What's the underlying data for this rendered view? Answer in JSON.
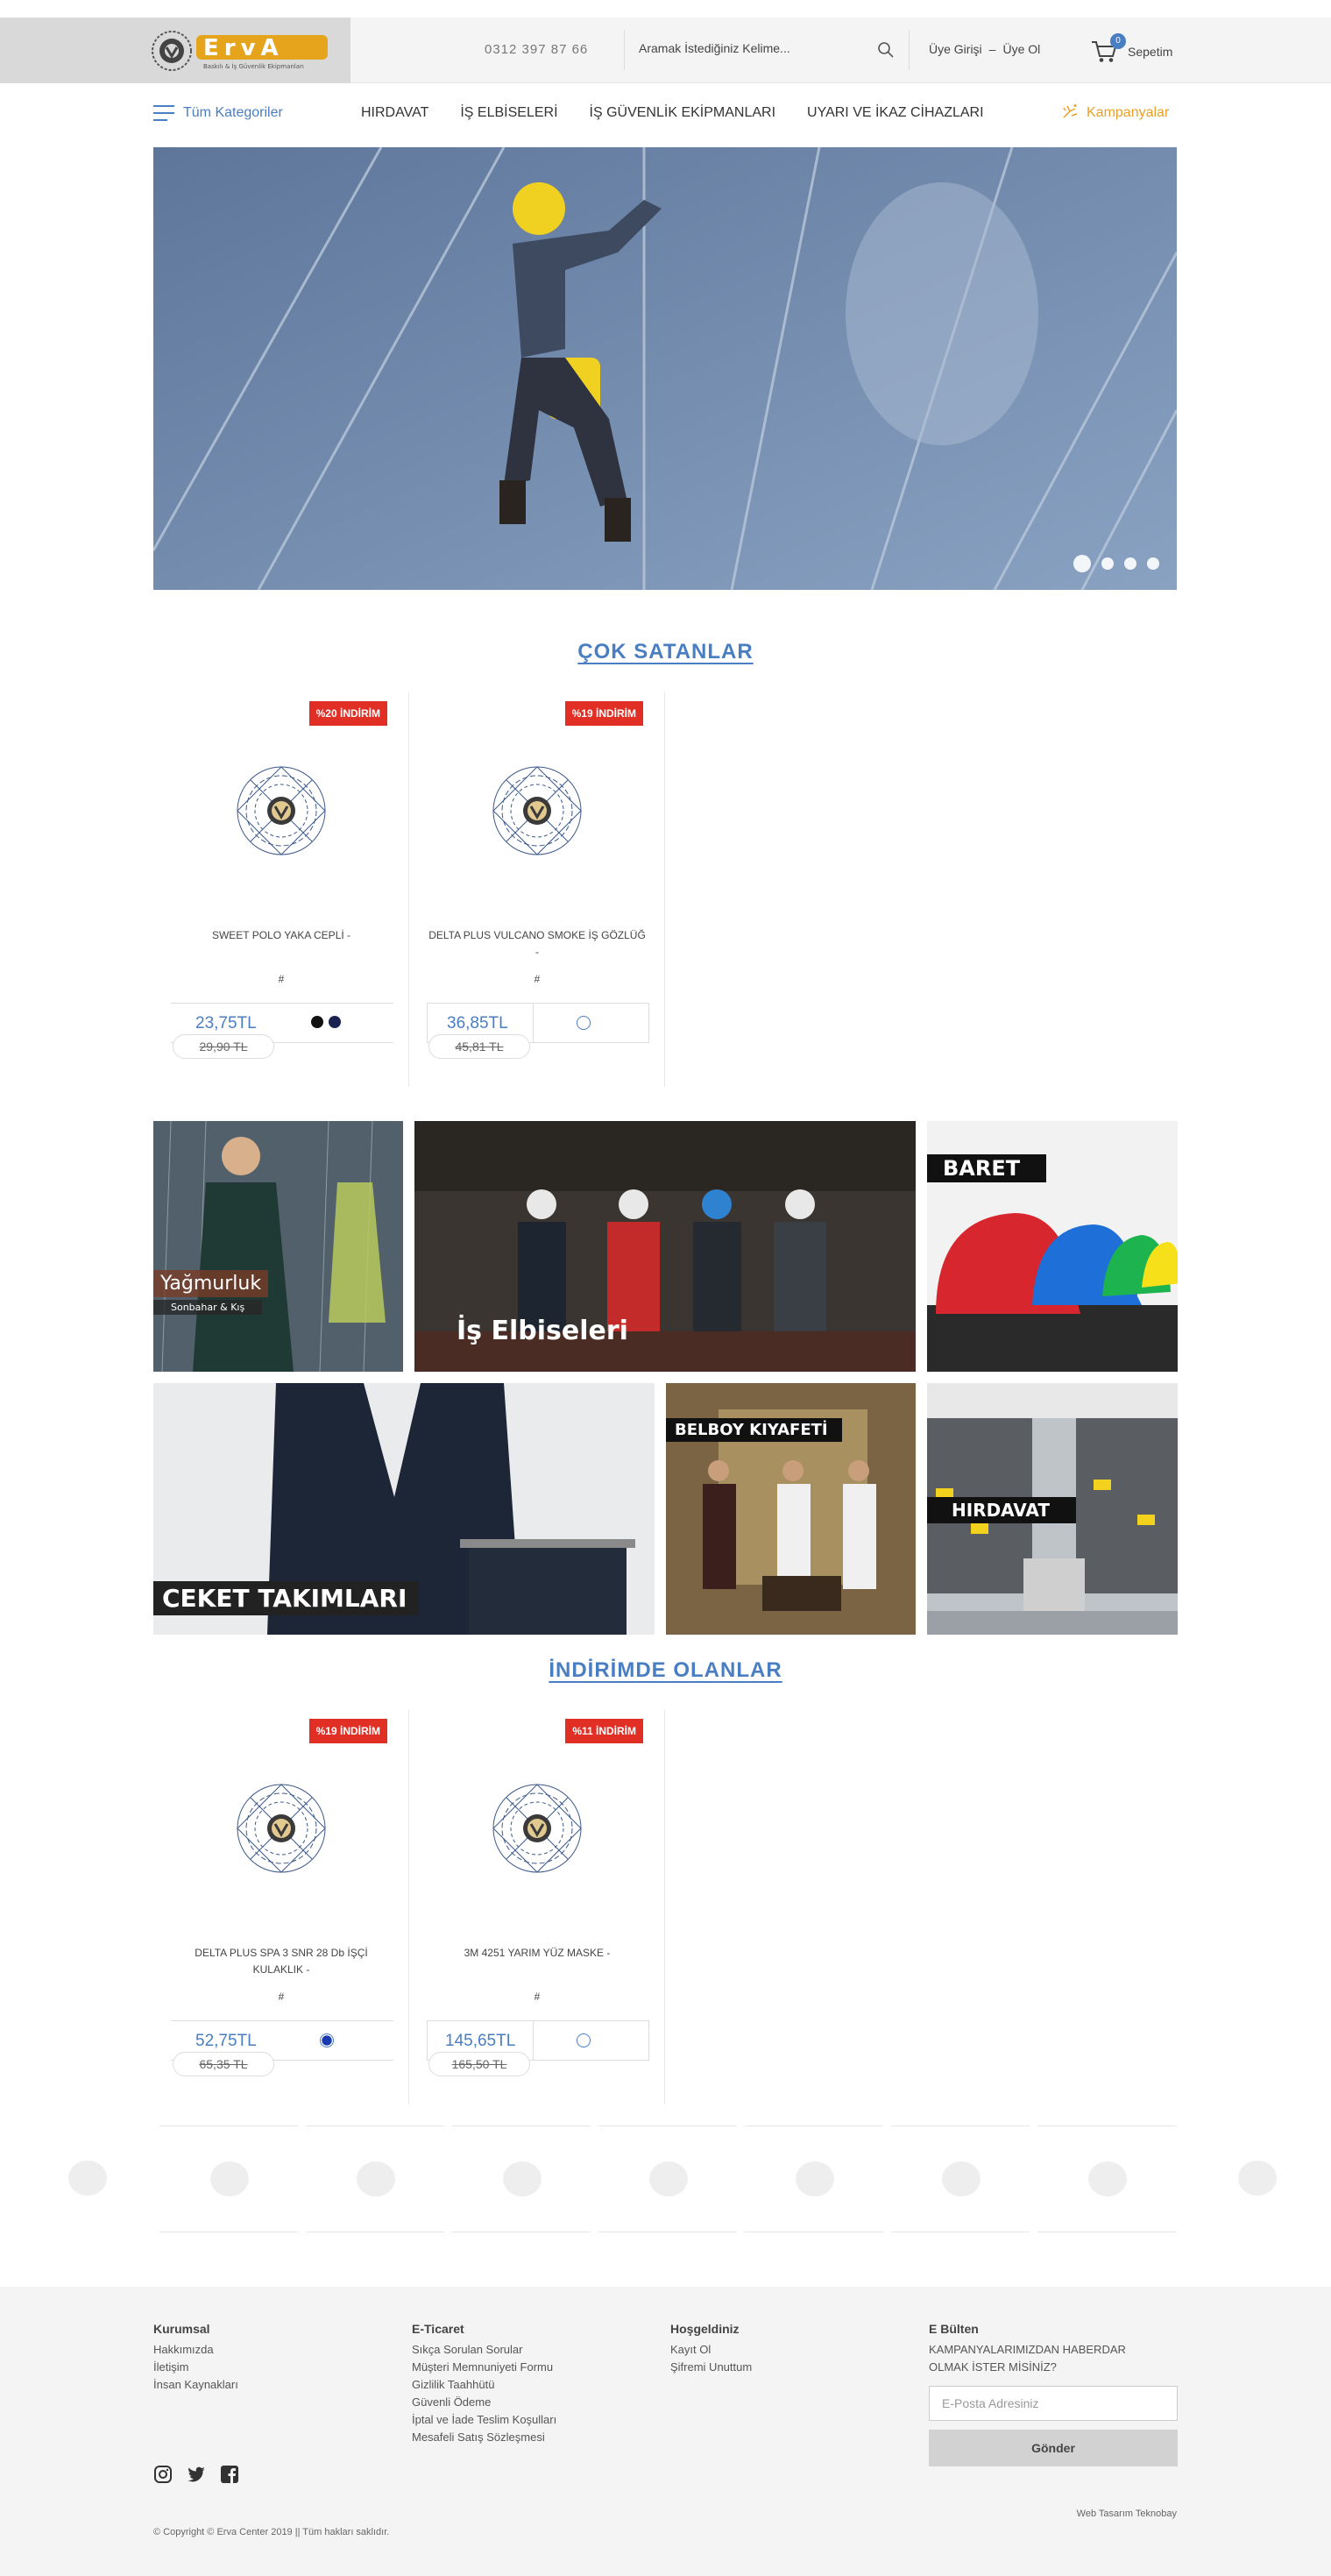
{
  "header": {
    "phone": "0312 397 87 66",
    "search_placeholder": "Aramak İstediğiniz Kelime...",
    "login": "Üye Girişi",
    "separator": "–",
    "register": "Üye Ol",
    "cart_count": "0",
    "cart_label": "Sepetim",
    "logo_text": "ErvA",
    "logo_subtitle": "Baskılı & İş Güvenlik Ekipmanları"
  },
  "nav": {
    "all_categories": "Tüm Kategoriler",
    "items": [
      "HIRDAVAT",
      "İŞ ELBİSELERİ",
      "İŞ GÜVENLİK EKİPMANLARI",
      "UYARI VE İKAZ CİHAZLARI"
    ],
    "campaigns": "Kampanyalar"
  },
  "slider": {
    "dot_count": 4,
    "active_dot": 1
  },
  "bestsellers": {
    "title": "ÇOK SATANLAR",
    "products": [
      {
        "discount": "%20 İNDİRİM",
        "name": "SWEET POLO YAKA CEPLİ -",
        "code": "#",
        "price": "23,75TL",
        "old_price": "29,90 TL",
        "swatches": [
          "#111111",
          "#1a2350"
        ]
      },
      {
        "discount": "%19 İNDİRİM",
        "name": "DELTA PLUS VULCANO SMOKE İŞ GÖZLÜĞ -",
        "code": "#",
        "price": "36,85TL",
        "old_price": "45,81 TL",
        "swatches": [
          "outline"
        ]
      }
    ]
  },
  "banners": {
    "yagmurluk": "Yağmurluk",
    "yagmurluk_sub": "Sonbahar & Kış",
    "is_elbiseleri": "İş Elbiseleri",
    "baret": "BARET",
    "ceket": "CEKET TAKIMLARI",
    "belboy": "BELBOY KIYAFETİ",
    "hirdavat": "HIRDAVAT"
  },
  "on_sale": {
    "title": "İNDİRİMDE OLANLAR",
    "products": [
      {
        "discount": "%19 İNDİRİM",
        "name": "DELTA PLUS SPA 3 SNR 28 Db İŞÇİ KULAKLIK -",
        "code": "#",
        "price": "52,75TL",
        "old_price": "65,35 TL",
        "swatches": [
          "filled-blue"
        ]
      },
      {
        "discount": "%11 İNDİRİM",
        "name": "3M 4251 YARIM YÜZ MASKE -",
        "code": "#",
        "price": "145,65TL",
        "old_price": "165,50 TL",
        "swatches": [
          "outline"
        ]
      }
    ]
  },
  "footer": {
    "kurumsal": {
      "title": "Kurumsal",
      "links": [
        "Hakkımızda",
        "İletişim",
        "İnsan Kaynakları"
      ]
    },
    "eticaret": {
      "title": "E-Ticaret",
      "links": [
        "Sıkça Sorulan Sorular",
        "Müşteri Memnuniyeti Formu",
        "Gizlilik Taahhütü",
        "Güvenli Ödeme",
        "İptal ve İade Teslim Koşulları",
        "Mesafeli Satış Sözleşmesi"
      ]
    },
    "hosgeldiniz": {
      "title": "Hoşgeldiniz",
      "links": [
        "Kayıt Ol",
        "Şifremi Unuttum"
      ]
    },
    "bulten": {
      "title": "E Bülten",
      "text": "KAMPANYALARIMIZDAN HABERDAR OLMAK İSTER MİSİNİZ?",
      "placeholder": "E-Posta Adresiniz",
      "button": "Gönder"
    },
    "social": [
      "instagram-icon",
      "twitter-icon",
      "facebook-icon"
    ],
    "credit": "Web Tasarım Teknobay",
    "copyright": "© Copyright © Erva Center 2019 || Tüm hakları saklıdır."
  },
  "colors": {
    "accent": "#4a7ec3",
    "discount": "#e12f26",
    "campaign": "#e9a028"
  }
}
